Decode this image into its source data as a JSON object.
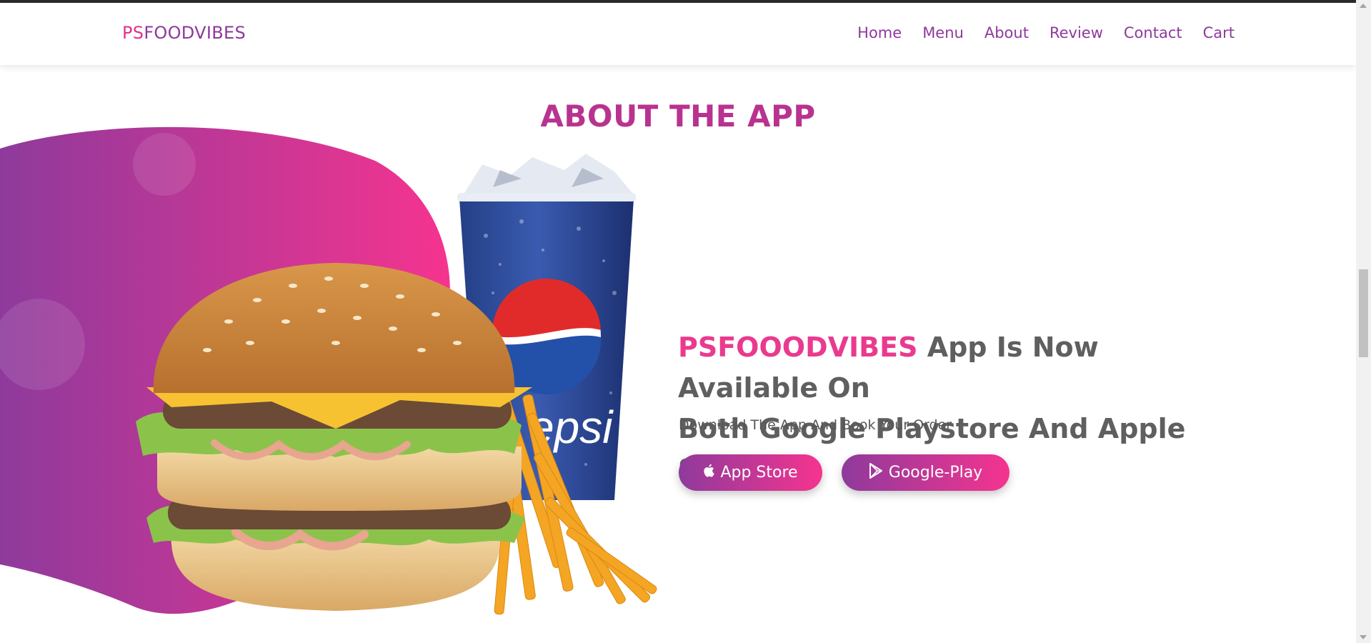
{
  "logo": {
    "prefix": "PS",
    "rest": "FOODVIBES"
  },
  "nav": [
    "Home",
    "Menu",
    "About",
    "Review",
    "Contact",
    "Cart"
  ],
  "section": {
    "title": "ABOUT THE APP"
  },
  "headline": {
    "brand": "PSFOOODVIBES",
    "line1_rest": " App Is Now Available On",
    "line2": "Both Google Playstore And Apple Store"
  },
  "subtitle": "Download The App And Book Your Order",
  "buttons": {
    "apple": "App Store",
    "google": "Google-Play"
  },
  "icons": {
    "apple": "apple-icon",
    "google": "google-play-icon"
  },
  "colors": {
    "brand_pink": "#ea3a8f",
    "brand_purple": "#8e3a9c",
    "heading_text": "#5f5f5f"
  }
}
